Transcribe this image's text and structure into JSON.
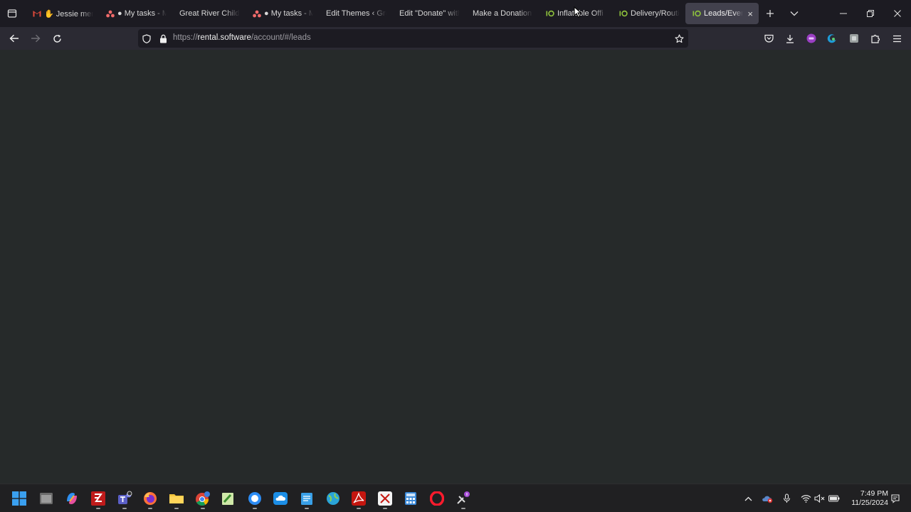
{
  "browser": {
    "tabs": [
      {
        "title": "✋ Jessie men",
        "favicon": "gmail-icon",
        "active": false
      },
      {
        "title": "● My tasks - M",
        "favicon": "asana-icon",
        "active": false
      },
      {
        "title": "Great River Childre",
        "favicon": "none",
        "active": false
      },
      {
        "title": "● My tasks - M",
        "favicon": "asana-icon",
        "active": false
      },
      {
        "title": "Edit Themes ‹ Grea",
        "favicon": "none",
        "active": false
      },
      {
        "title": "Edit \"Donate\" with",
        "favicon": "none",
        "active": false
      },
      {
        "title": "Make a Donation ·",
        "favicon": "none",
        "active": false
      },
      {
        "title": "Inflatable Offi",
        "favicon": "io-icon",
        "active": false
      },
      {
        "title": "Delivery/Routi",
        "favicon": "io-icon",
        "active": false
      },
      {
        "title": "Leads/Event",
        "favicon": "io-icon",
        "active": true
      }
    ],
    "close_tab_glyph": "×",
    "url": {
      "scheme": "https://",
      "host": "rental.software",
      "path": "/account/#/leads"
    },
    "accent_color": "#42414d"
  },
  "taskbar": {
    "clock": {
      "time": "7:49 PM",
      "date": "11/25/2024"
    },
    "pinned_apps": [
      "windows-start",
      "file-explorer-window",
      "copilot",
      "filezilla",
      "teams",
      "firefox",
      "file-explorer",
      "chrome",
      "notepad-plus",
      "signal",
      "onedrive",
      "notepad",
      "web-browser",
      "acrobat",
      "snip",
      "calculator",
      "opera",
      "tools"
    ]
  }
}
